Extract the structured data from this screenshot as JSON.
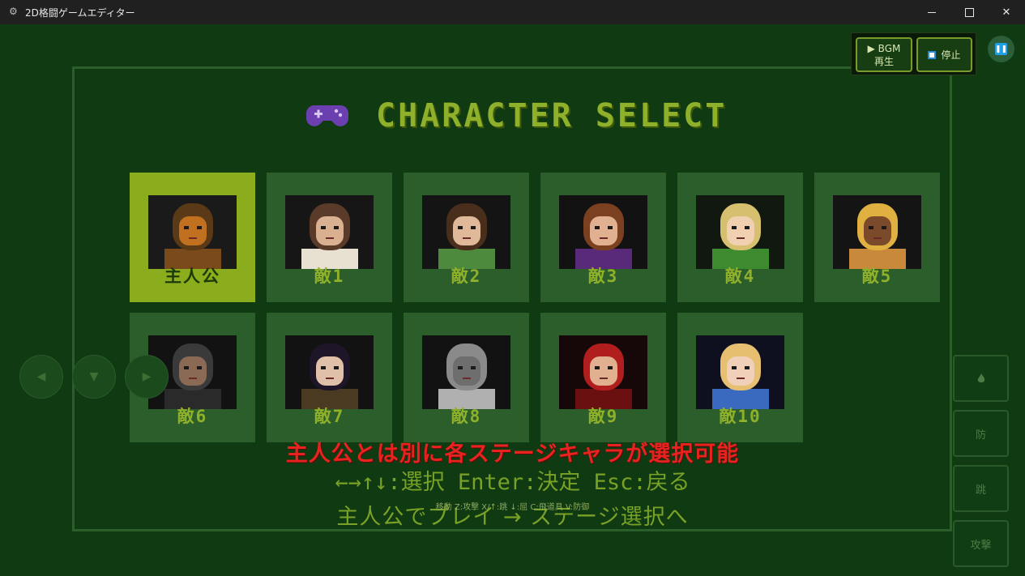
{
  "window": {
    "title": "2D格闘ゲームエディター",
    "app_icon": "gear-icon"
  },
  "screen": {
    "heading": "CHARACTER SELECT",
    "heading_icon": "gamepad-icon"
  },
  "characters": [
    {
      "name": "主人公",
      "selected": true,
      "portrait": "orc-warrior"
    },
    {
      "name": "敵1",
      "selected": false,
      "portrait": "brown-hair-girl"
    },
    {
      "name": "敵2",
      "selected": false,
      "portrait": "green-tunic-girl"
    },
    {
      "name": "敵3",
      "selected": false,
      "portrait": "purple-witch"
    },
    {
      "name": "敵4",
      "selected": false,
      "portrait": "blonde-elf"
    },
    {
      "name": "敵5",
      "selected": false,
      "portrait": "dark-skin-blonde"
    },
    {
      "name": "敵6",
      "selected": false,
      "portrait": "hooded-rogue"
    },
    {
      "name": "敵7",
      "selected": false,
      "portrait": "dark-hair-woman"
    },
    {
      "name": "敵8",
      "selected": false,
      "portrait": "armored-knight"
    },
    {
      "name": "敵9",
      "selected": false,
      "portrait": "red-hat-mage"
    },
    {
      "name": "敵10",
      "selected": false,
      "portrait": "sword-knight-girl"
    }
  ],
  "subtitle": "主人公とは別に各ステージキャラが選択可能",
  "controls_help": "←→↑↓:選択  Enter:決定  Esc:戻る",
  "tiny_help": "移動  Z:攻撃  X/↑:跳  ↓:屈  C:飛道具  V:防御",
  "start_line": "主人公でプレイ → ステージ選択へ",
  "bgm": {
    "play_label": "▶ BGM再生",
    "stop_label": "停止"
  },
  "dpad": {
    "left": "◀",
    "down": "▼",
    "right": "▶"
  },
  "actions": {
    "special": "fire-icon",
    "guard": "防",
    "jump": "跳",
    "attack": "攻撃"
  },
  "colors": {
    "background": "#0f3a12",
    "card": "#2c5e2c",
    "card_selected": "#8bac1c",
    "heading": "#8fb02a",
    "subtitle": "#e8231f"
  }
}
